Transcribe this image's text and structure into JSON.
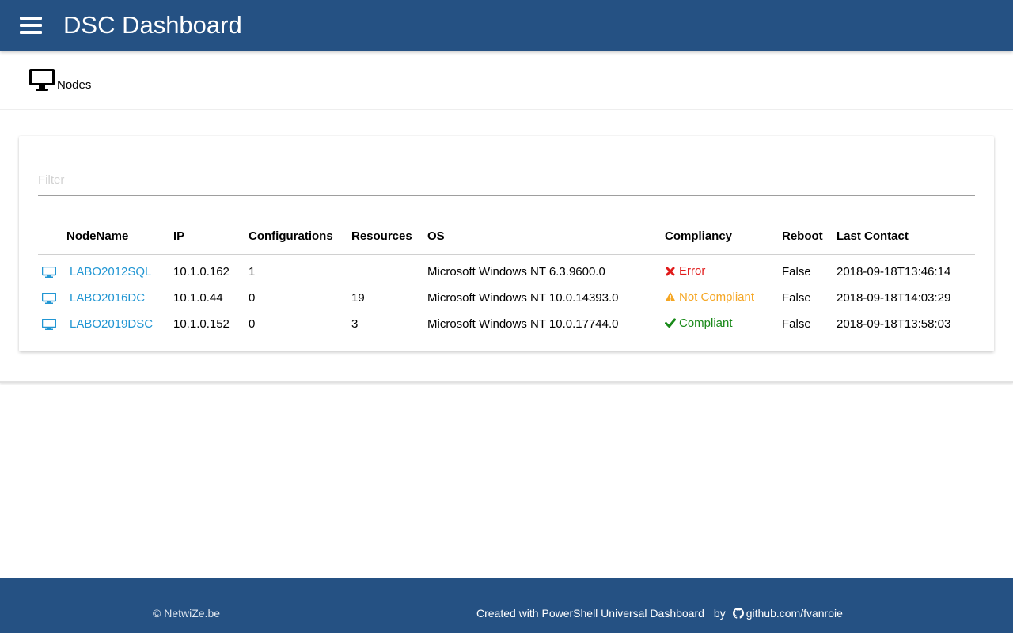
{
  "app": {
    "title": "DSC Dashboard"
  },
  "page": {
    "section_label": "Nodes"
  },
  "filter": {
    "placeholder": "Filter",
    "value": ""
  },
  "table": {
    "columns": [
      "",
      "NodeName",
      "IP",
      "Configurations",
      "Resources",
      "OS",
      "Compliancy",
      "Reboot",
      "Last Contact"
    ],
    "rows": [
      {
        "name": "LABO2012SQL",
        "ip": "10.1.0.162",
        "configurations": "1",
        "resources": "",
        "os": "Microsoft Windows NT 6.3.9600.0",
        "compliancy": "Error",
        "compliancy_icon": "x-icon",
        "reboot": "False",
        "last_contact": "2018-09-18T13:46:14"
      },
      {
        "name": "LABO2016DC",
        "ip": "10.1.0.44",
        "configurations": "0",
        "resources": "19",
        "os": "Microsoft Windows NT 10.0.14393.0",
        "compliancy": "Not Compliant",
        "compliancy_icon": "warning-icon",
        "reboot": "False",
        "last_contact": "2018-09-18T14:03:29"
      },
      {
        "name": "LABO2019DSC",
        "ip": "10.1.0.152",
        "configurations": "0",
        "resources": "3",
        "os": "Microsoft Windows NT 10.0.17744.0",
        "compliancy": "Compliant",
        "compliancy_icon": "check-icon",
        "reboot": "False",
        "last_contact": "2018-09-18T13:58:03"
      }
    ]
  },
  "footer": {
    "copyright": "© NetwiZe.be",
    "created_with": "Created with PowerShell Universal Dashboard",
    "by": "by",
    "link": "github.com/fvanroie"
  },
  "colors": {
    "navbar": "#255183",
    "link": "#2196d3",
    "error": "#e01b1b",
    "warning": "#f5a623",
    "success": "#1a8a1a"
  }
}
